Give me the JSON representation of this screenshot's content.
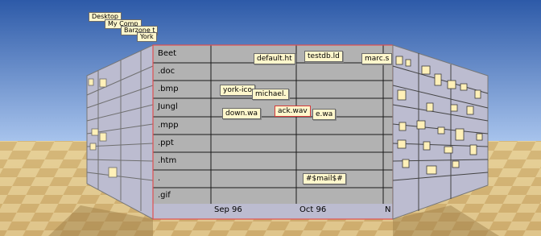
{
  "breadcrumbs": [
    "Desktop",
    "My Comp",
    "Barzone t",
    "York"
  ],
  "file_types": [
    "Beet",
    ".doc",
    ".bmp",
    "Jungl",
    ".mpp",
    ".ppt",
    ".htm",
    ".",
    ".gif"
  ],
  "timeline": [
    "Sep 96",
    "Oct 96",
    "N"
  ],
  "file_tags": [
    {
      "label": "default.ht",
      "selected": false
    },
    {
      "label": "testdb.ld",
      "selected": false
    },
    {
      "label": "marc.s",
      "selected": false
    },
    {
      "label": "york-ico",
      "selected": false
    },
    {
      "label": "michael.",
      "selected": false
    },
    {
      "label": "down.wa",
      "selected": false
    },
    {
      "label": "ack.wav",
      "selected": true
    },
    {
      "label": "e.wa",
      "selected": false
    },
    {
      "label": "#$mail$#",
      "selected": false
    }
  ],
  "colors": {
    "sky_top": "#2d5aa8",
    "sky_bottom": "#a7c3ec",
    "wall": "#b2b2b2",
    "side_wall": "#bcbcd0",
    "tag_fill": "#fff7cc",
    "selection": "#d63a3a"
  }
}
